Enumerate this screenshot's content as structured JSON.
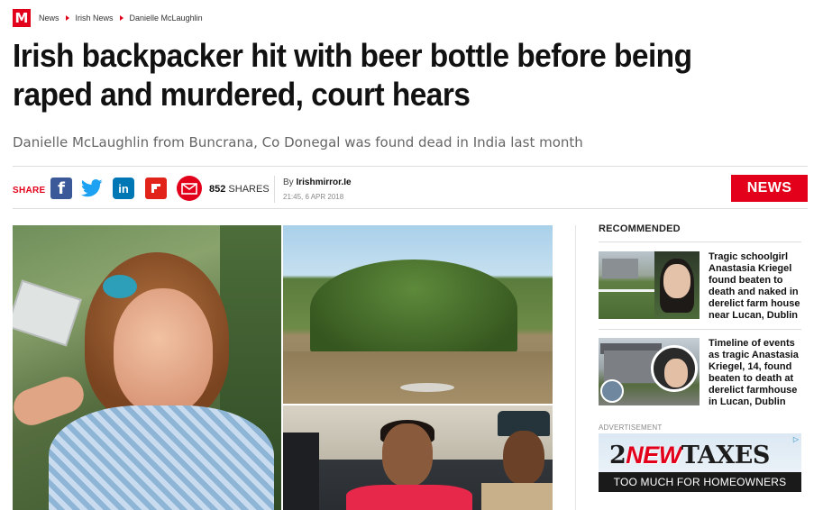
{
  "brand": {
    "logo_letter": "M",
    "color": "#e3001b"
  },
  "breadcrumb": [
    "News",
    "Irish News",
    "Danielle McLaughlin"
  ],
  "article": {
    "headline": "Irish backpacker hit with beer bottle before being raped and murdered, court hears",
    "standfirst": "Danielle McLaughlin from Buncrana, Co Donegal was found dead in India last month"
  },
  "share": {
    "label": "SHARE",
    "icons": [
      "facebook-icon",
      "twitter-icon",
      "linkedin-icon",
      "flipboard-icon",
      "email-icon"
    ],
    "linkedin_text": "in",
    "facebook_text": "f",
    "count": "852",
    "count_label": "SHARES"
  },
  "byline": {
    "prefix": "By",
    "author": "Irishmirror.Ie",
    "timestamp": "21:45, 6 APR 2018"
  },
  "section_badge": "NEWS",
  "recommended": {
    "title": "RECOMMENDED",
    "items": [
      {
        "text": "Tragic schoolgirl Anastasia Kriegel found beaten to death and naked in derelict farm house near Lucan, Dublin"
      },
      {
        "text": "Timeline of events as tragic Anastasia Kriegel, 14, found beaten to death at derelict farmhouse in Lucan, Dublin"
      }
    ]
  },
  "advertisement": {
    "label": "ADVERTISEMENT",
    "num": "2",
    "highlight": "NEW",
    "word": "TAXES",
    "tagline": "TOO MUCH FOR HOMEOWNERS",
    "adchoices": "▷"
  }
}
